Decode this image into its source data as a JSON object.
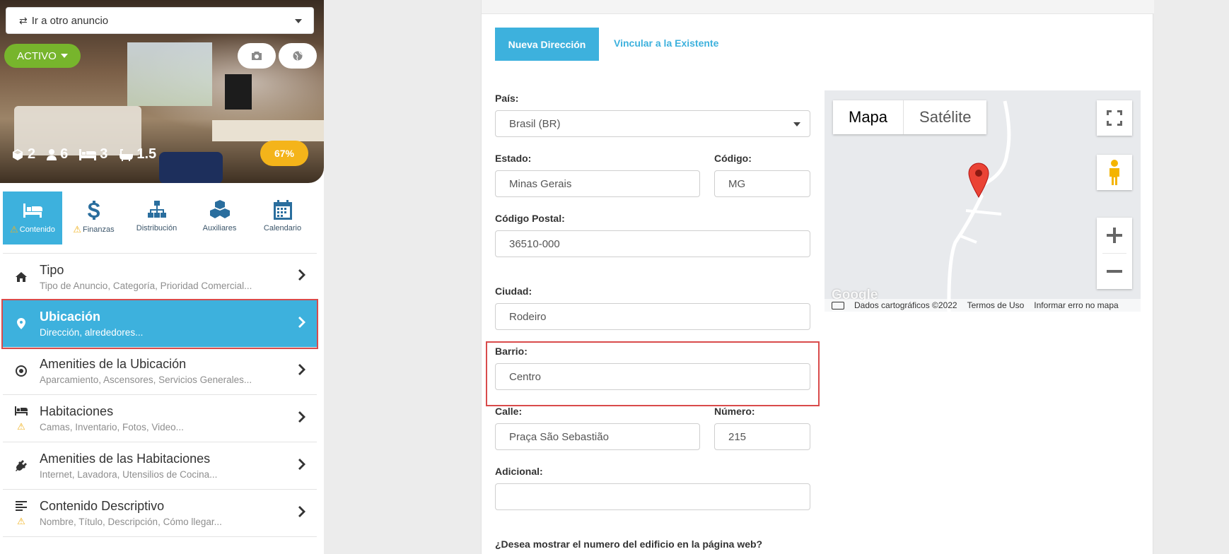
{
  "sidebar": {
    "goto_select": "Ir a otro anuncio",
    "status": "ACTIVO",
    "stats": {
      "boxes": "2",
      "guests": "6",
      "beds": "3",
      "baths": "1.5"
    },
    "progress": "67%",
    "tabs": [
      {
        "label": "Contenido",
        "icon": "bed-icon",
        "warning": true
      },
      {
        "label": "Finanzas",
        "icon": "dollar-icon",
        "warning": true
      },
      {
        "label": "Distribución",
        "icon": "sitemap-icon",
        "warning": false
      },
      {
        "label": "Auxiliares",
        "icon": "cubes-icon",
        "warning": false
      },
      {
        "label": "Calendario",
        "icon": "calendar-icon",
        "warning": false
      }
    ],
    "menu": [
      {
        "title": "Tipo",
        "subtitle": "Tipo de Anuncio, Categoría, Prioridad Comercial...",
        "icon": "home-icon"
      },
      {
        "title": "Ubicación",
        "subtitle": "Dirección, alrededores...",
        "icon": "map-pin-icon"
      },
      {
        "title": "Amenities de la Ubicación",
        "subtitle": "Aparcamiento, Ascensores, Servicios Generales...",
        "icon": "dot-circle-icon"
      },
      {
        "title": "Habitaciones",
        "subtitle": "Camas, Inventario, Fotos, Video...",
        "icon": "bed-icon"
      },
      {
        "title": "Amenities de las Habitaciones",
        "subtitle": "Internet, Lavadora, Utensilios de Cocina...",
        "icon": "plug-icon"
      },
      {
        "title": "Contenido Descriptivo",
        "subtitle": "Nombre, Título, Descripción, Cómo llegar...",
        "icon": "align-left-icon"
      }
    ]
  },
  "main": {
    "btn_new": "Nueva Dirección",
    "btn_link": "Vincular a la Existente",
    "labels": {
      "pais": "País:",
      "estado": "Estado:",
      "codigo": "Código:",
      "postal": "Código Postal:",
      "ciudad": "Ciudad:",
      "barrio": "Barrio:",
      "calle": "Calle:",
      "numero": "Número:",
      "adicional": "Adicional:"
    },
    "values": {
      "pais": "Brasil (BR)",
      "estado": "Minas Gerais",
      "codigo": "MG",
      "postal": "36510-000",
      "ciudad": "Rodeiro",
      "barrio": "Centro",
      "calle": "Praça São Sebastião",
      "numero": "215",
      "adicional": ""
    },
    "question": "¿Desea mostrar el numero del edificio en la página web?"
  },
  "map": {
    "type_map": "Mapa",
    "type_satellite": "Satélite",
    "data_credit": "Dados cartográficos ©2022",
    "terms": "Termos de Uso",
    "report": "Informar erro no mapa",
    "logo": "Google"
  },
  "colors": {
    "accent": "#3db1dd",
    "status_green": "#77b52c",
    "progress_orange": "#f4b41a",
    "highlight_red": "#d94b4b"
  }
}
